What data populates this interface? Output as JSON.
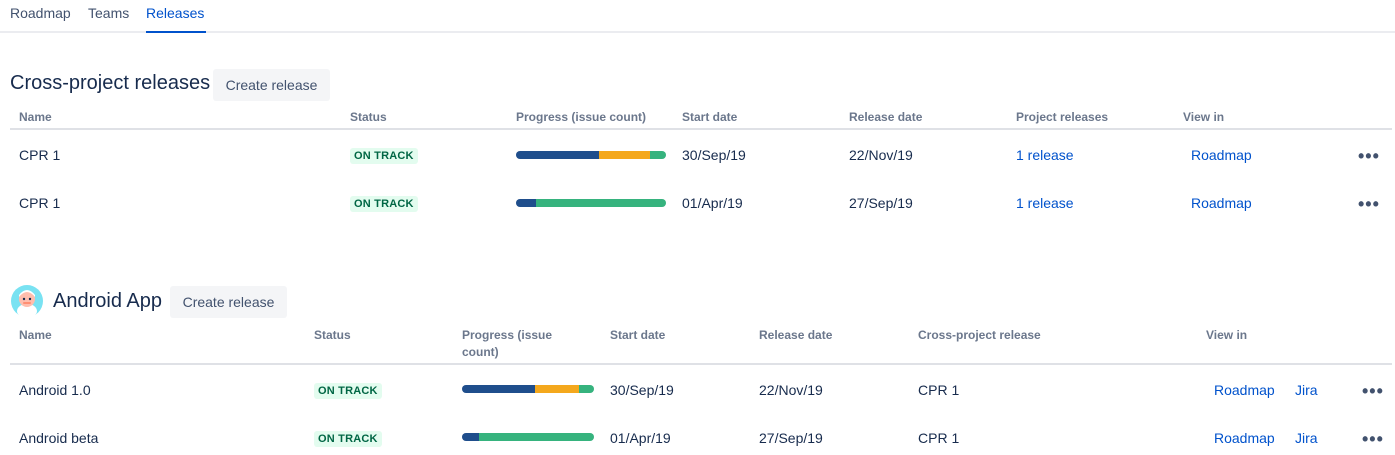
{
  "nav": {
    "tabs": [
      {
        "label": "Roadmap"
      },
      {
        "label": "Teams"
      },
      {
        "label": "Releases"
      }
    ]
  },
  "cross": {
    "title": "Cross-project releases",
    "create_label": "Create release",
    "headers": {
      "name": "Name",
      "status": "Status",
      "progress": "Progress (issue count)",
      "start": "Start date",
      "release": "Release date",
      "project_releases": "Project releases",
      "view_in": "View in"
    },
    "rows": [
      {
        "name": "CPR 1",
        "status": "ON TRACK",
        "progress": {
          "done": 0.55,
          "in_progress": 0.34,
          "todo": 0.11
        },
        "start": "30/Sep/19",
        "release": "22/Nov/19",
        "project_releases": "1 release",
        "view_in": "Roadmap",
        "more": "•••"
      },
      {
        "name": "CPR 1",
        "status": "ON TRACK",
        "progress": {
          "done": 0.13,
          "in_progress": 0.0,
          "todo": 0.87
        },
        "start": "01/Apr/19",
        "release": "27/Sep/19",
        "project_releases": "1 release",
        "view_in": "Roadmap",
        "more": "•••"
      }
    ]
  },
  "android": {
    "title": "Android App",
    "create_label": "Create release",
    "headers": {
      "name": "Name",
      "status": "Status",
      "progress_line1": "Progress (issue",
      "progress_line2": "count)",
      "start": "Start date",
      "release": "Release date",
      "cross_release": "Cross-project release",
      "view_in": "View in"
    },
    "rows": [
      {
        "name": "Android 1.0",
        "status": "ON TRACK",
        "progress": {
          "done": 0.55,
          "in_progress": 0.34,
          "todo": 0.11
        },
        "start": "30/Sep/19",
        "release": "22/Nov/19",
        "cross_release": "CPR 1",
        "view_roadmap": "Roadmap",
        "view_jira": "Jira",
        "more": "•••"
      },
      {
        "name": "Android beta",
        "status": "ON TRACK",
        "progress": {
          "done": 0.13,
          "in_progress": 0.0,
          "todo": 0.87
        },
        "start": "01/Apr/19",
        "release": "27/Sep/19",
        "cross_release": "CPR 1",
        "view_roadmap": "Roadmap",
        "view_jira": "Jira",
        "more": "•••"
      }
    ]
  },
  "colors": {
    "done": "#1f4e8c",
    "in_progress": "#f4a81d",
    "todo": "#36b37e",
    "link": "#0052cc",
    "lozenge_bg": "#e3fcef",
    "lozenge_text": "#006644"
  },
  "icons": {
    "project_avatar": "android-project-avatar-icon",
    "more": "more-actions-icon"
  }
}
